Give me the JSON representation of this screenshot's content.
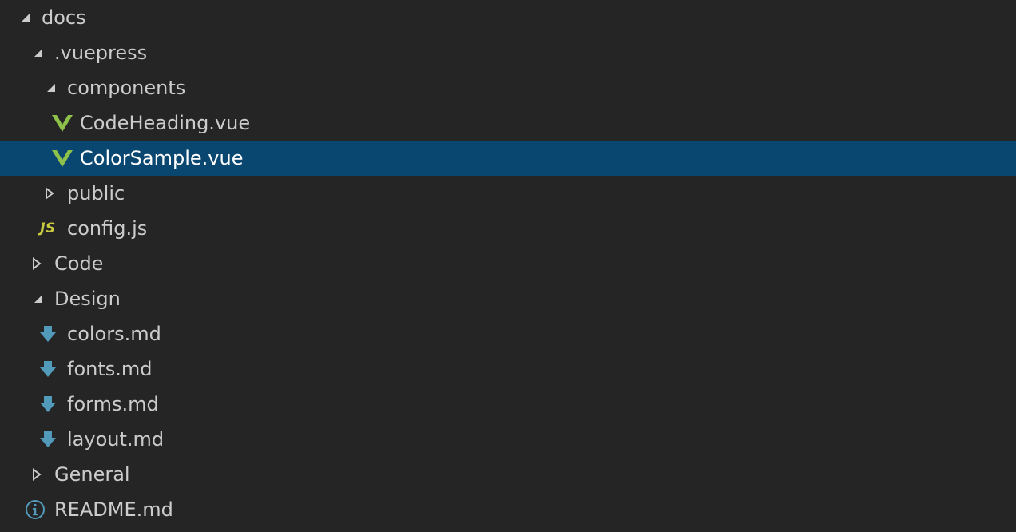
{
  "explorer": {
    "items": [
      {
        "label": "docs",
        "icon": "chevron-down-icon",
        "depth": 0,
        "selected": false
      },
      {
        "label": ".vuepress",
        "icon": "chevron-down-icon",
        "depth": 1,
        "selected": false
      },
      {
        "label": "components",
        "icon": "chevron-down-icon",
        "depth": 2,
        "selected": false
      },
      {
        "label": "CodeHeading.vue",
        "icon": "vue-file-icon",
        "depth": 3,
        "selected": false
      },
      {
        "label": "ColorSample.vue",
        "icon": "vue-file-icon",
        "depth": 3,
        "selected": true
      },
      {
        "label": "public",
        "icon": "chevron-right-icon",
        "depth": 2,
        "selected": false
      },
      {
        "label": "config.js",
        "icon": "js-file-icon",
        "depth": 2,
        "selected": false,
        "badge": "JS"
      },
      {
        "label": "Code",
        "icon": "chevron-right-icon",
        "depth": 1,
        "selected": false
      },
      {
        "label": "Design",
        "icon": "chevron-down-icon",
        "depth": 1,
        "selected": false
      },
      {
        "label": "colors.md",
        "icon": "markdown-file-icon",
        "depth": 2,
        "selected": false
      },
      {
        "label": "fonts.md",
        "icon": "markdown-file-icon",
        "depth": 2,
        "selected": false
      },
      {
        "label": "forms.md",
        "icon": "markdown-file-icon",
        "depth": 2,
        "selected": false
      },
      {
        "label": "layout.md",
        "icon": "markdown-file-icon",
        "depth": 2,
        "selected": false
      },
      {
        "label": "General",
        "icon": "chevron-right-icon",
        "depth": 1,
        "selected": false
      },
      {
        "label": "README.md",
        "icon": "info-file-icon",
        "depth": 1,
        "selected": false
      }
    ]
  },
  "colors": {
    "background": "#252526",
    "selection": "#094771",
    "text": "#cccccc",
    "vue": "#8dc149",
    "markdown": "#519aba",
    "js": "#cbcb41"
  }
}
